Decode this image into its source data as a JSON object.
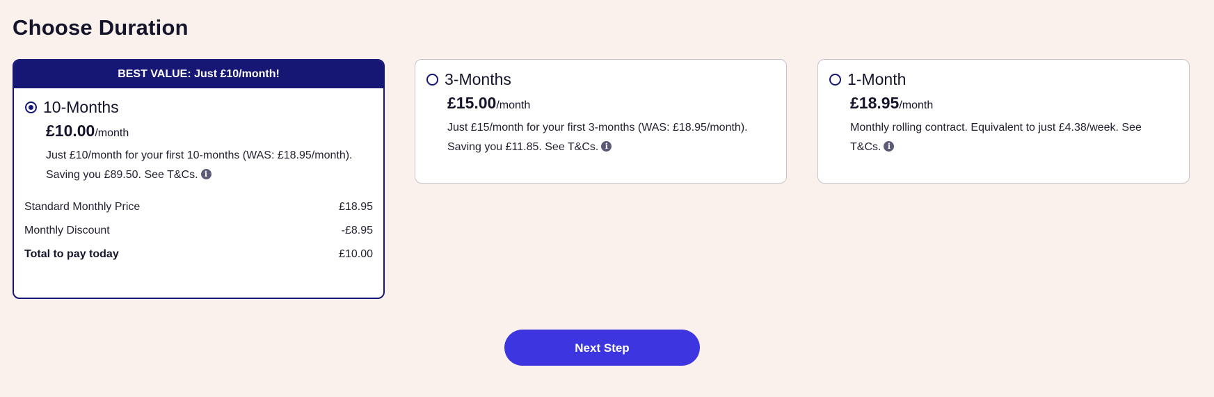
{
  "page": {
    "title": "Choose Duration"
  },
  "plans": [
    {
      "banner": "BEST VALUE: Just £10/month!",
      "name": "10-Months",
      "price": "£10.00",
      "per": "/month",
      "description": "Just £10/month for your first 10-months (WAS: £18.95/month). Saving you £89.50. See T&Cs.",
      "selected": true,
      "breakdown": [
        {
          "label": "Standard Monthly Price",
          "value": "£18.95"
        },
        {
          "label": "Monthly Discount",
          "value": "-£8.95"
        },
        {
          "label": "Total to pay today",
          "value": "£10.00"
        }
      ]
    },
    {
      "name": "3-Months",
      "price": "£15.00",
      "per": "/month",
      "description": "Just £15/month for your first 3-months (WAS: £18.95/month). Saving you £11.85. See T&Cs.",
      "selected": false
    },
    {
      "name": "1-Month",
      "price": "£18.95",
      "per": "/month",
      "description": "Monthly rolling contract. Equivalent to just £4.38/week. See T&Cs.",
      "selected": false
    }
  ],
  "icons": {
    "info": "info-icon",
    "info_glyph": "i"
  },
  "actions": {
    "next_label": "Next Step"
  },
  "colors": {
    "background": "#faf1ec",
    "navy": "#161675",
    "primary_button": "#3d35e0",
    "card": "#ffffff"
  }
}
